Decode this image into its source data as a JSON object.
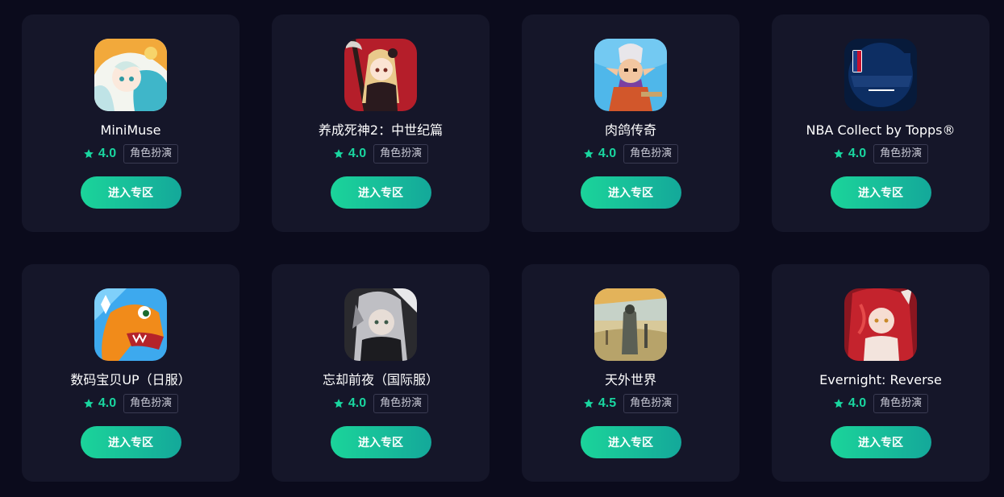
{
  "colors": {
    "background": "#0b0b1c",
    "card": "#151629",
    "accent": "#19d6a0",
    "button_start": "#1bd49a",
    "button_end": "#14a89a"
  },
  "games": [
    {
      "name": "MiniMuse",
      "rating": "4.0",
      "tag": "角色扮演",
      "button": "进入专区",
      "icon": "minimuse-app-icon"
    },
    {
      "name": "养成死神2：中世纪篇",
      "rating": "4.0",
      "tag": "角色扮演",
      "button": "进入专区",
      "icon": "reaper-girl-app-icon"
    },
    {
      "name": "肉鸽传奇",
      "rating": "4.0",
      "tag": "角色扮演",
      "button": "进入专区",
      "icon": "elf-warrior-app-icon"
    },
    {
      "name": "NBA Collect by Topps®",
      "rating": "4.0",
      "tag": "角色扮演",
      "button": "进入专区",
      "icon": "nba-collect-app-icon"
    },
    {
      "name": "数码宝贝UP（日服）",
      "rating": "4.0",
      "tag": "角色扮演",
      "button": "进入专区",
      "icon": "agumon-app-icon"
    },
    {
      "name": "忘却前夜（国际服）",
      "rating": "4.0",
      "tag": "角色扮演",
      "button": "进入专区",
      "icon": "silver-hair-girl-app-icon"
    },
    {
      "name": "天外世界",
      "rating": "4.5",
      "tag": "角色扮演",
      "button": "进入专区",
      "icon": "outer-worlds-app-icon"
    },
    {
      "name": "Evernight: Reverse",
      "rating": "4.0",
      "tag": "角色扮演",
      "button": "进入专区",
      "icon": "red-hair-girl-app-icon"
    }
  ]
}
